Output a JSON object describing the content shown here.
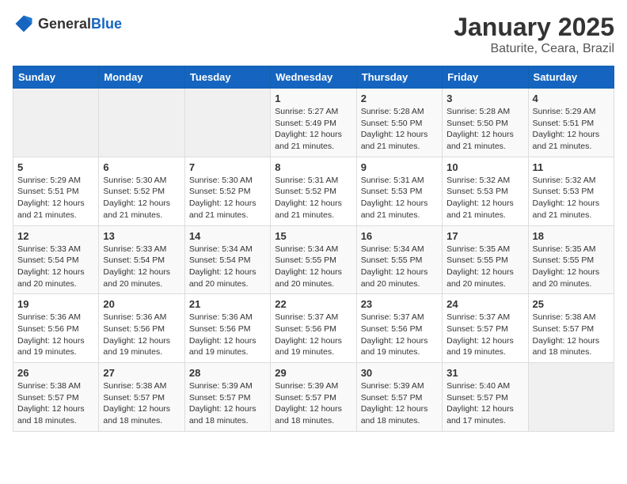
{
  "header": {
    "logo_general": "General",
    "logo_blue": "Blue",
    "title": "January 2025",
    "location": "Baturite, Ceara, Brazil"
  },
  "weekdays": [
    "Sunday",
    "Monday",
    "Tuesday",
    "Wednesday",
    "Thursday",
    "Friday",
    "Saturday"
  ],
  "weeks": [
    [
      {
        "day": "",
        "info": ""
      },
      {
        "day": "",
        "info": ""
      },
      {
        "day": "",
        "info": ""
      },
      {
        "day": "1",
        "info": "Sunrise: 5:27 AM\nSunset: 5:49 PM\nDaylight: 12 hours\nand 21 minutes."
      },
      {
        "day": "2",
        "info": "Sunrise: 5:28 AM\nSunset: 5:50 PM\nDaylight: 12 hours\nand 21 minutes."
      },
      {
        "day": "3",
        "info": "Sunrise: 5:28 AM\nSunset: 5:50 PM\nDaylight: 12 hours\nand 21 minutes."
      },
      {
        "day": "4",
        "info": "Sunrise: 5:29 AM\nSunset: 5:51 PM\nDaylight: 12 hours\nand 21 minutes."
      }
    ],
    [
      {
        "day": "5",
        "info": "Sunrise: 5:29 AM\nSunset: 5:51 PM\nDaylight: 12 hours\nand 21 minutes."
      },
      {
        "day": "6",
        "info": "Sunrise: 5:30 AM\nSunset: 5:52 PM\nDaylight: 12 hours\nand 21 minutes."
      },
      {
        "day": "7",
        "info": "Sunrise: 5:30 AM\nSunset: 5:52 PM\nDaylight: 12 hours\nand 21 minutes."
      },
      {
        "day": "8",
        "info": "Sunrise: 5:31 AM\nSunset: 5:52 PM\nDaylight: 12 hours\nand 21 minutes."
      },
      {
        "day": "9",
        "info": "Sunrise: 5:31 AM\nSunset: 5:53 PM\nDaylight: 12 hours\nand 21 minutes."
      },
      {
        "day": "10",
        "info": "Sunrise: 5:32 AM\nSunset: 5:53 PM\nDaylight: 12 hours\nand 21 minutes."
      },
      {
        "day": "11",
        "info": "Sunrise: 5:32 AM\nSunset: 5:53 PM\nDaylight: 12 hours\nand 21 minutes."
      }
    ],
    [
      {
        "day": "12",
        "info": "Sunrise: 5:33 AM\nSunset: 5:54 PM\nDaylight: 12 hours\nand 20 minutes."
      },
      {
        "day": "13",
        "info": "Sunrise: 5:33 AM\nSunset: 5:54 PM\nDaylight: 12 hours\nand 20 minutes."
      },
      {
        "day": "14",
        "info": "Sunrise: 5:34 AM\nSunset: 5:54 PM\nDaylight: 12 hours\nand 20 minutes."
      },
      {
        "day": "15",
        "info": "Sunrise: 5:34 AM\nSunset: 5:55 PM\nDaylight: 12 hours\nand 20 minutes."
      },
      {
        "day": "16",
        "info": "Sunrise: 5:34 AM\nSunset: 5:55 PM\nDaylight: 12 hours\nand 20 minutes."
      },
      {
        "day": "17",
        "info": "Sunrise: 5:35 AM\nSunset: 5:55 PM\nDaylight: 12 hours\nand 20 minutes."
      },
      {
        "day": "18",
        "info": "Sunrise: 5:35 AM\nSunset: 5:55 PM\nDaylight: 12 hours\nand 20 minutes."
      }
    ],
    [
      {
        "day": "19",
        "info": "Sunrise: 5:36 AM\nSunset: 5:56 PM\nDaylight: 12 hours\nand 19 minutes."
      },
      {
        "day": "20",
        "info": "Sunrise: 5:36 AM\nSunset: 5:56 PM\nDaylight: 12 hours\nand 19 minutes."
      },
      {
        "day": "21",
        "info": "Sunrise: 5:36 AM\nSunset: 5:56 PM\nDaylight: 12 hours\nand 19 minutes."
      },
      {
        "day": "22",
        "info": "Sunrise: 5:37 AM\nSunset: 5:56 PM\nDaylight: 12 hours\nand 19 minutes."
      },
      {
        "day": "23",
        "info": "Sunrise: 5:37 AM\nSunset: 5:56 PM\nDaylight: 12 hours\nand 19 minutes."
      },
      {
        "day": "24",
        "info": "Sunrise: 5:37 AM\nSunset: 5:57 PM\nDaylight: 12 hours\nand 19 minutes."
      },
      {
        "day": "25",
        "info": "Sunrise: 5:38 AM\nSunset: 5:57 PM\nDaylight: 12 hours\nand 18 minutes."
      }
    ],
    [
      {
        "day": "26",
        "info": "Sunrise: 5:38 AM\nSunset: 5:57 PM\nDaylight: 12 hours\nand 18 minutes."
      },
      {
        "day": "27",
        "info": "Sunrise: 5:38 AM\nSunset: 5:57 PM\nDaylight: 12 hours\nand 18 minutes."
      },
      {
        "day": "28",
        "info": "Sunrise: 5:39 AM\nSunset: 5:57 PM\nDaylight: 12 hours\nand 18 minutes."
      },
      {
        "day": "29",
        "info": "Sunrise: 5:39 AM\nSunset: 5:57 PM\nDaylight: 12 hours\nand 18 minutes."
      },
      {
        "day": "30",
        "info": "Sunrise: 5:39 AM\nSunset: 5:57 PM\nDaylight: 12 hours\nand 18 minutes."
      },
      {
        "day": "31",
        "info": "Sunrise: 5:40 AM\nSunset: 5:57 PM\nDaylight: 12 hours\nand 17 minutes."
      },
      {
        "day": "",
        "info": ""
      }
    ]
  ]
}
